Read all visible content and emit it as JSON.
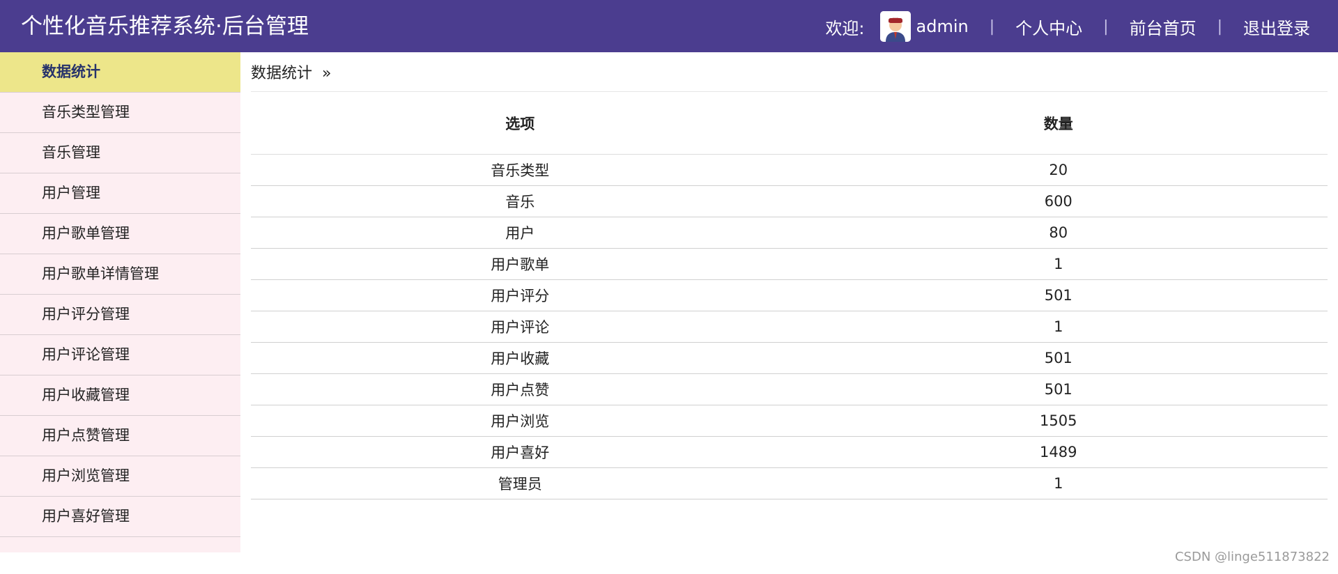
{
  "header": {
    "title": "个性化音乐推荐系统·后台管理",
    "welcome": "欢迎:",
    "username": "admin",
    "separator": "|",
    "links": [
      "个人中心",
      "前台首页",
      "退出登录"
    ]
  },
  "sidebar": {
    "items": [
      {
        "label": "数据统计",
        "active": true
      },
      {
        "label": "音乐类型管理"
      },
      {
        "label": "音乐管理"
      },
      {
        "label": "用户管理"
      },
      {
        "label": "用户歌单管理"
      },
      {
        "label": "用户歌单详情管理"
      },
      {
        "label": "用户评分管理"
      },
      {
        "label": "用户评论管理"
      },
      {
        "label": "用户收藏管理"
      },
      {
        "label": "用户点赞管理"
      },
      {
        "label": "用户浏览管理"
      },
      {
        "label": "用户喜好管理"
      }
    ]
  },
  "breadcrumb": {
    "label": "数据统计",
    "arrow": "»"
  },
  "table": {
    "columns": [
      "选项",
      "数量"
    ],
    "rows": [
      [
        "音乐类型",
        "20"
      ],
      [
        "音乐",
        "600"
      ],
      [
        "用户",
        "80"
      ],
      [
        "用户歌单",
        "1"
      ],
      [
        "用户评分",
        "501"
      ],
      [
        "用户评论",
        "1"
      ],
      [
        "用户收藏",
        "501"
      ],
      [
        "用户点赞",
        "501"
      ],
      [
        "用户浏览",
        "1505"
      ],
      [
        "用户喜好",
        "1489"
      ],
      [
        "管理员",
        "1"
      ]
    ]
  },
  "watermark": "CSDN @linge511873822",
  "colors": {
    "header_bg": "#4b3d8f",
    "sidebar_bg": "#fdeef2",
    "active_bg": "#ede68a",
    "active_text": "#27336b"
  }
}
